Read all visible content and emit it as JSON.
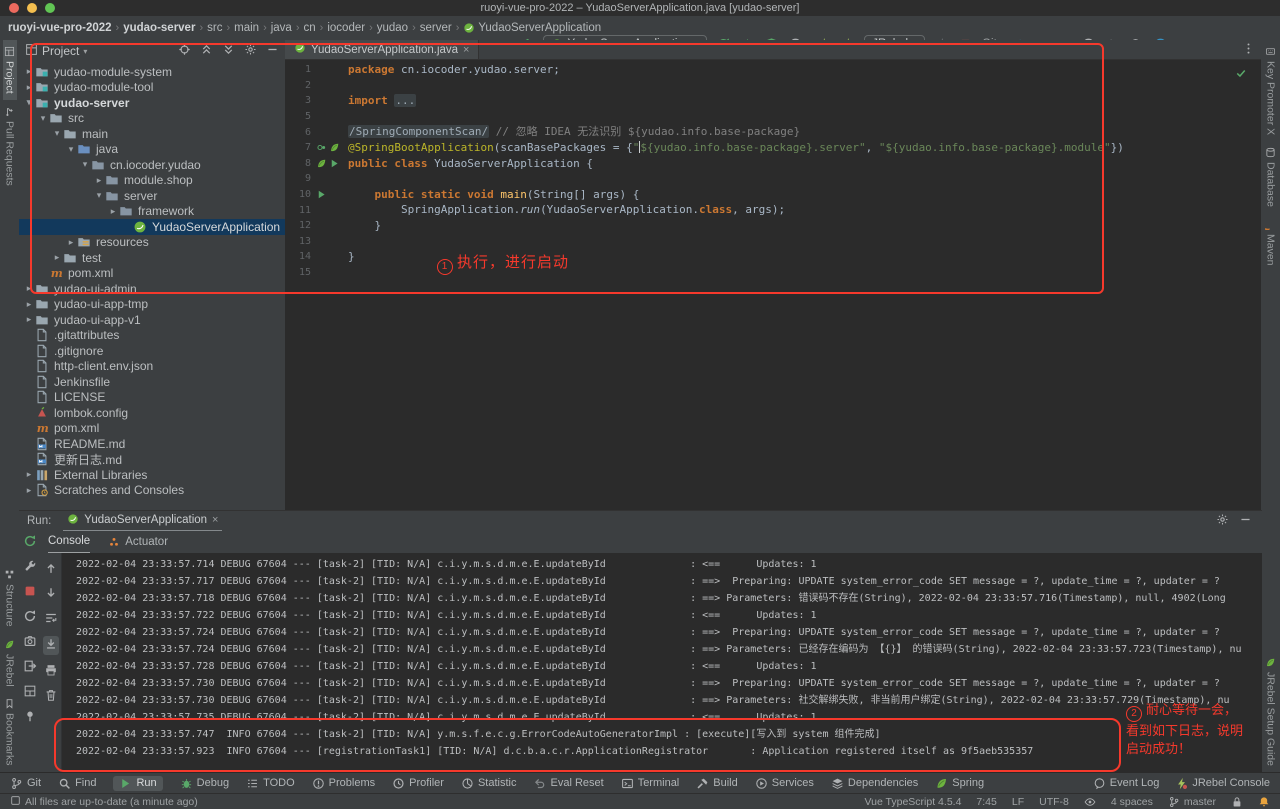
{
  "titlebar": {
    "title": "ruoyi-vue-pro-2022 – YudaoServerApplication.java [yudao-server]"
  },
  "navbar": {
    "breadcrumbs": [
      {
        "label": "ruoyi-vue-pro-2022",
        "bold": true
      },
      {
        "label": "yudao-server",
        "bold": true
      },
      {
        "label": "src"
      },
      {
        "label": "main"
      },
      {
        "label": "java"
      },
      {
        "label": "cn"
      },
      {
        "label": "iocoder"
      },
      {
        "label": "yudao"
      },
      {
        "label": "server"
      },
      {
        "label": "YudaoServerApplication",
        "icon": "springboot"
      }
    ],
    "run_config": "YudaoServerApplication",
    "jrebel_label": "JRebel",
    "git_label": "Git:",
    "tools": [
      {
        "icon": "hammer",
        "name": "build"
      },
      {
        "type": "combo",
        "icon": "springboot",
        "label_key": "run_config",
        "name": "run-configuration-select"
      },
      {
        "icon": "rerun",
        "name": "run"
      },
      {
        "icon": "bug",
        "name": "debug"
      },
      {
        "icon": "shield",
        "name": "run-with-coverage"
      },
      {
        "icon": "clockplay",
        "name": "profiler",
        "caret": true
      },
      {
        "icon": "bolt",
        "name": "jrebel-run"
      },
      {
        "icon": "bolt",
        "name": "jrebel-debug"
      },
      {
        "type": "combo",
        "label_key": "jrebel_label",
        "name": "jrebel-select"
      },
      {
        "icon": "boltgray",
        "name": "jrebel-inactive"
      },
      {
        "icon": "stop",
        "name": "stop"
      },
      {
        "type": "label",
        "label_key": "git_label",
        "name": "git-label"
      },
      {
        "icon": "gitdl",
        "name": "git-update"
      },
      {
        "icon": "check",
        "name": "git-commit"
      },
      {
        "icon": "push",
        "name": "git-push"
      },
      {
        "icon": "clock",
        "name": "recent-history"
      },
      {
        "icon": "undo",
        "name": "rollback"
      },
      {
        "icon": "search",
        "name": "search-everywhere"
      },
      {
        "icon": "bluedot",
        "name": "ide-update"
      }
    ]
  },
  "left_strip": {
    "top": [
      {
        "label": "Project",
        "icon": "project",
        "active": true
      },
      {
        "label": "Pull Requests",
        "icon": "pull"
      }
    ],
    "bottom": [
      {
        "label": "Structure",
        "icon": "structure"
      },
      {
        "label": "JRebel",
        "icon": "leaf"
      },
      {
        "label": "Bookmarks",
        "icon": "bookmark"
      }
    ]
  },
  "right_strip": {
    "top": [
      {
        "label": "Key Promoter X",
        "icon": "keypromoter"
      },
      {
        "label": "Database",
        "icon": "database"
      },
      {
        "label": "Maven",
        "icon": "maven"
      }
    ],
    "bottom": [
      {
        "label": "JRebel Setup Guide",
        "icon": "leaf"
      }
    ]
  },
  "project_panel": {
    "title": "Project",
    "actions": [
      "target",
      "collup",
      "colldown",
      "gear",
      "minus"
    ],
    "tree": [
      {
        "label": "yudao-module-system",
        "level": 0,
        "chev": "r",
        "icon": "module"
      },
      {
        "label": "yudao-module-tool",
        "level": 0,
        "chev": "r",
        "icon": "module"
      },
      {
        "label": "yudao-server",
        "level": 0,
        "chev": "d",
        "icon": "module",
        "bold": true
      },
      {
        "label": "src",
        "level": 1,
        "chev": "d",
        "icon": "folder"
      },
      {
        "label": "main",
        "level": 2,
        "chev": "d",
        "icon": "folder"
      },
      {
        "label": "java",
        "level": 3,
        "chev": "d",
        "icon": "srcjava"
      },
      {
        "label": "cn.iocoder.yudao",
        "level": 4,
        "chev": "d",
        "icon": "package"
      },
      {
        "label": "module.shop",
        "level": 5,
        "chev": "r",
        "icon": "package"
      },
      {
        "label": "server",
        "level": 5,
        "chev": "d",
        "icon": "package"
      },
      {
        "label": "framework",
        "level": 6,
        "chev": "r",
        "icon": "package"
      },
      {
        "label": "YudaoServerApplication",
        "level": 7,
        "chev": "",
        "icon": "springboot",
        "selected": true
      },
      {
        "label": "resources",
        "level": 3,
        "chev": "r",
        "icon": "resources"
      },
      {
        "label": "test",
        "level": 2,
        "chev": "r",
        "icon": "folder"
      },
      {
        "label": "pom.xml",
        "level": 1,
        "chev": "",
        "icon": "maven"
      },
      {
        "label": "yudao-ui-admin",
        "level": 0,
        "chev": "r",
        "icon": "folder"
      },
      {
        "label": "yudao-ui-app-tmp",
        "level": 0,
        "chev": "r",
        "icon": "folder"
      },
      {
        "label": "yudao-ui-app-v1",
        "level": 0,
        "chev": "r",
        "icon": "folder"
      },
      {
        "label": ".gitattributes",
        "level": 0,
        "chev": "",
        "icon": "file"
      },
      {
        "label": ".gitignore",
        "level": 0,
        "chev": "",
        "icon": "file"
      },
      {
        "label": "http-client.env.json",
        "level": 0,
        "chev": "",
        "icon": "file"
      },
      {
        "label": "Jenkinsfile",
        "level": 0,
        "chev": "",
        "icon": "file"
      },
      {
        "label": "LICENSE",
        "level": 0,
        "chev": "",
        "icon": "file"
      },
      {
        "label": "lombok.config",
        "level": 0,
        "chev": "",
        "icon": "lombok"
      },
      {
        "label": "pom.xml",
        "level": 0,
        "chev": "",
        "icon": "maven"
      },
      {
        "label": "README.md",
        "level": 0,
        "chev": "",
        "icon": "md"
      },
      {
        "label": "更新日志.md",
        "level": 0,
        "chev": "",
        "icon": "md"
      },
      {
        "label": "External Libraries",
        "level": 0,
        "chev": "r",
        "icon": "lib"
      },
      {
        "label": "Scratches and Consoles",
        "level": 0,
        "chev": "r",
        "icon": "scratch"
      }
    ]
  },
  "editor": {
    "tab": "YudaoServerApplication.java",
    "annotation": {
      "num": "1",
      "text": "执行，进行启动"
    },
    "lines": [
      {
        "n": "1",
        "g": [],
        "c": [
          [
            "kw",
            "package"
          ],
          [
            "pl",
            " cn.iocoder.yudao.server;"
          ]
        ]
      },
      {
        "n": "2",
        "g": [],
        "c": []
      },
      {
        "n": "3",
        "g": [],
        "c": [
          [
            "kw",
            "import"
          ],
          [
            "pl",
            " "
          ],
          [
            "fold",
            "..."
          ]
        ]
      },
      {
        "n": "5",
        "g": [],
        "c": []
      },
      {
        "n": "6",
        "g": [],
        "c": [
          [
            "fold",
            "/SpringComponentScan/"
          ],
          [
            "cmt",
            " // 忽略 IDEA 无法识别 ${yudao.info.base-package}"
          ]
        ]
      },
      {
        "n": "7",
        "g": [
          "bean",
          "leaf"
        ],
        "c": [
          [
            "ann",
            "@SpringBootApplication"
          ],
          [
            "pl",
            "(scanBasePackages = {"
          ],
          [
            "str",
            "\""
          ],
          [
            "caret",
            ""
          ],
          [
            "str",
            "${yudao.info.base-package}.server\""
          ],
          [
            "pl",
            ", "
          ],
          [
            "str",
            "\"${yudao.info.base-package}.module\""
          ],
          [
            "pl",
            "})"
          ]
        ]
      },
      {
        "n": "8",
        "g": [
          "leaf",
          "play"
        ],
        "c": [
          [
            "kw",
            "public class"
          ],
          [
            "pl",
            " YudaoServerApplication {"
          ]
        ]
      },
      {
        "n": "9",
        "g": [],
        "c": []
      },
      {
        "n": "10",
        "g": [
          "play"
        ],
        "c": [
          [
            "pl",
            "    "
          ],
          [
            "kw",
            "public static void"
          ],
          [
            "meth",
            " main"
          ],
          [
            "pl",
            "(String[] args) {"
          ]
        ]
      },
      {
        "n": "11",
        "g": [],
        "c": [
          [
            "pl",
            "        SpringApplication."
          ],
          [
            "itl",
            "run"
          ],
          [
            "pl",
            "(YudaoServerApplication."
          ],
          [
            "kw",
            "class"
          ],
          [
            "pl",
            ", args);"
          ]
        ]
      },
      {
        "n": "12",
        "g": [],
        "c": [
          [
            "pl",
            "    }"
          ]
        ]
      },
      {
        "n": "13",
        "g": [],
        "c": []
      },
      {
        "n": "14",
        "g": [],
        "c": [
          [
            "pl",
            "}"
          ]
        ]
      },
      {
        "n": "15",
        "g": [],
        "c": []
      }
    ]
  },
  "run_panel": {
    "label": "Run:",
    "tab": "YudaoServerApplication",
    "tabs": [
      {
        "label": "Console",
        "active": true
      },
      {
        "label": "Actuator",
        "icon": "actuator"
      }
    ],
    "controls": [
      "rerun",
      "wrench",
      "stop",
      "restart",
      "camera",
      "exit",
      "layout",
      "pin"
    ],
    "console_controls": [
      "up",
      "down",
      "softwrap",
      "scrollend",
      "print",
      "trash"
    ],
    "logs": [
      "2022-02-04 23:33:57.714 DEBUG 67604 --- [task-2] [TID: N/A] c.i.y.m.s.d.m.e.E.updateById              : <==      Updates: 1",
      "2022-02-04 23:33:57.717 DEBUG 67604 --- [task-2] [TID: N/A] c.i.y.m.s.d.m.e.E.updateById              : ==>  Preparing: UPDATE system_error_code SET message = ?, update_time = ?, updater = ?",
      "2022-02-04 23:33:57.718 DEBUG 67604 --- [task-2] [TID: N/A] c.i.y.m.s.d.m.e.E.updateById              : ==> Parameters: 错误码不存在(String), 2022-02-04 23:33:57.716(Timestamp), null, 4902(Long",
      "2022-02-04 23:33:57.722 DEBUG 67604 --- [task-2] [TID: N/A] c.i.y.m.s.d.m.e.E.updateById              : <==      Updates: 1",
      "2022-02-04 23:33:57.724 DEBUG 67604 --- [task-2] [TID: N/A] c.i.y.m.s.d.m.e.E.updateById              : ==>  Preparing: UPDATE system_error_code SET message = ?, update_time = ?, updater = ?",
      "2022-02-04 23:33:57.724 DEBUG 67604 --- [task-2] [TID: N/A] c.i.y.m.s.d.m.e.E.updateById              : ==> Parameters: 已经存在编码为 【{}】 的错误码(String), 2022-02-04 23:33:57.723(Timestamp), nu",
      "2022-02-04 23:33:57.728 DEBUG 67604 --- [task-2] [TID: N/A] c.i.y.m.s.d.m.e.E.updateById              : <==      Updates: 1",
      "2022-02-04 23:33:57.730 DEBUG 67604 --- [task-2] [TID: N/A] c.i.y.m.s.d.m.e.E.updateById              : ==>  Preparing: UPDATE system_error_code SET message = ?, update_time = ?, updater = ?",
      "2022-02-04 23:33:57.730 DEBUG 67604 --- [task-2] [TID: N/A] c.i.y.m.s.d.m.e.E.updateById              : ==> Parameters: 社交解绑失败, 非当前用户绑定(String), 2022-02-04 23:33:57.729(Timestamp), nu",
      "2022-02-04 23:33:57.735 DEBUG 67604 --- [task-2] [TID: N/A] c.i.y.m.s.d.m.e.E.updateById              : <==      Updates: 1",
      "2022-02-04 23:33:57.747  INFO 67604 --- [task-2] [TID: N/A] y.m.s.f.e.c.g.ErrorCodeAutoGeneratorImpl : [execute][写入到 system 组件完成]",
      "2022-02-04 23:33:57.923  INFO 67604 --- [registrationTask1] [TID: N/A] d.c.b.a.c.r.ApplicationRegistrator       : Application registered itself as 9f5aeb535357"
    ],
    "annotation": {
      "num": "2",
      "lines": [
        "耐心等待一会，",
        "看到如下日志，说明",
        "启动成功！"
      ]
    }
  },
  "bottom_bar": {
    "items": [
      {
        "label": "Git",
        "icon": "branch"
      },
      {
        "label": "Find",
        "icon": "search"
      },
      {
        "label": "Run",
        "icon": "playsm",
        "active": true
      },
      {
        "label": "Debug",
        "icon": "bug"
      },
      {
        "label": "TODO",
        "icon": "todo"
      },
      {
        "label": "Problems",
        "icon": "problem"
      },
      {
        "label": "Profiler",
        "icon": "clockplay"
      },
      {
        "label": "Statistic",
        "icon": "pie"
      },
      {
        "label": "Eval Reset",
        "icon": "undo"
      },
      {
        "label": "Terminal",
        "icon": "terminal"
      },
      {
        "label": "Build",
        "icon": "hammergray"
      },
      {
        "label": "Services",
        "icon": "playcircle"
      },
      {
        "label": "Dependencies",
        "icon": "stack"
      },
      {
        "label": "Spring",
        "icon": "leaf"
      }
    ],
    "right": [
      {
        "label": "Event Log",
        "icon": "balloon"
      },
      {
        "label": "JRebel Console",
        "icon": "jrebelconsole"
      }
    ]
  },
  "status_bar": {
    "left": "All files are up-to-date (a minute ago)",
    "items": [
      {
        "label": "Vue TypeScript 4.5.4"
      },
      {
        "label": "7:45"
      },
      {
        "label": "LF"
      },
      {
        "label": "UTF-8"
      },
      {
        "icon": "eye"
      },
      {
        "label": "4 spaces"
      },
      {
        "icon": "branch",
        "label": "master"
      },
      {
        "icon": "lock"
      },
      {
        "icon": "bell"
      }
    ]
  }
}
